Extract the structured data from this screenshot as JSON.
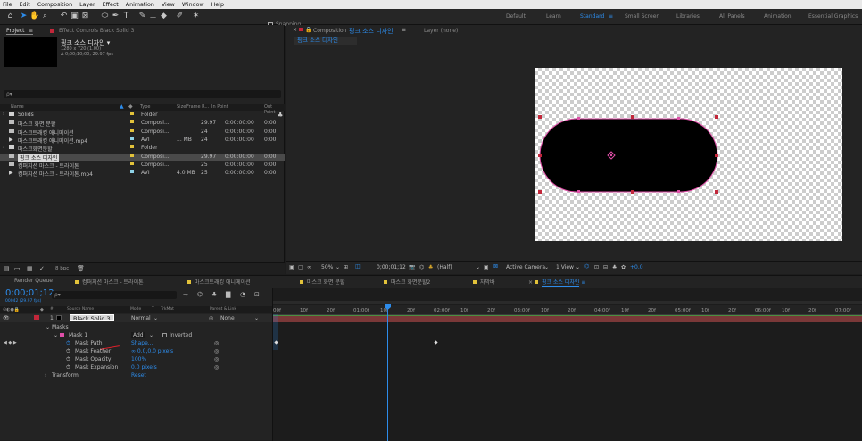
{
  "menu": [
    "File",
    "Edit",
    "Composition",
    "Layer",
    "Effect",
    "Animation",
    "View",
    "Window",
    "Help"
  ],
  "toolbar": {
    "snapping": "Snapping"
  },
  "workspaces": [
    "Default",
    "Learn",
    "Standard",
    "Small Screen",
    "Libraries",
    "All Panels",
    "Animation",
    "Essential Graphics"
  ],
  "project": {
    "tab": "Project",
    "tab_menu": "≡",
    "effect_controls": "Effect Controls Black Solid 3",
    "comp_name": "핑크 소스 디자인 ▾",
    "comp_res": "1280 x 720 (1.00)",
    "comp_dur": "Δ 0;00;10;00, 29.97 fps",
    "search_placeholder": "ρ▾",
    "columns": {
      "name": "Name",
      "type": "Type",
      "size": "Size",
      "frame_rate": "Frame R...",
      "in_point": "In Point",
      "out_point": "Out Point"
    },
    "items": [
      {
        "name": "Solids",
        "type": "Folder",
        "size": "",
        "fr": "",
        "in": "",
        "out": "",
        "color": "#e2c23a",
        "icon": "folder-icon"
      },
      {
        "name": "마스크 화면 분할",
        "type": "Composi...",
        "size": "",
        "fr": "29.97",
        "in": "0:00:00:00",
        "out": "0:00",
        "color": "#e2c23a",
        "icon": "composition-icon"
      },
      {
        "name": "마스크트래킹 애니메이션",
        "type": "Composi...",
        "size": "",
        "fr": "24",
        "in": "0:00:00:00",
        "out": "0:00",
        "color": "#e2c23a",
        "icon": "composition-icon"
      },
      {
        "name": "마스크트래킹 애니메이션.mp4",
        "type": "AVI",
        "size": "... MB",
        "fr": "24",
        "in": "0:00:00:00",
        "out": "0:00",
        "color": "#8fd3e8",
        "icon": "footage-icon"
      },
      {
        "name": "마스크화면분할",
        "type": "Folder",
        "size": "",
        "fr": "",
        "in": "",
        "out": "",
        "color": "#e2c23a",
        "icon": "folder-icon"
      },
      {
        "name": "핑크 소스 디자인",
        "type": "Composi...",
        "size": "",
        "fr": "29.97",
        "in": "0:00:00:00",
        "out": "0:00",
        "color": "#e2c23a",
        "icon": "composition-icon"
      },
      {
        "name": "컴퍼지션 마스크 - 트라이톤",
        "type": "Composi...",
        "size": "",
        "fr": "25",
        "in": "0:00:00:00",
        "out": "0:00",
        "color": "#e2c23a",
        "icon": "composition-icon"
      },
      {
        "name": "컴퍼지션 마스크 - 트라이톤.mp4",
        "type": "AVI",
        "size": "4.0 MB",
        "fr": "25",
        "in": "0:00:00:00",
        "out": "0:00",
        "color": "#8fd3e8",
        "icon": "footage-icon"
      }
    ],
    "bpc": "8 bpc"
  },
  "comp": {
    "tab_prefix": "Composition",
    "tab_name": "핑크 소스 디자인",
    "tab_menu": "≡",
    "layer_tab": "Layer (none)",
    "subtab": "핑크 소스 디자인",
    "zoom": "50%",
    "timecode": "0;00;01;12",
    "resolution": "(Half)",
    "camera": "Active Camera",
    "views": "1 View",
    "exposure": "+0.0"
  },
  "timeline": {
    "render_queue": "Render Queue",
    "tabs": [
      {
        "name": "컴퍼지션 마스크 - 트라이톤",
        "color": "#e2c23a"
      },
      {
        "name": "마스크트래킹 애니메이션",
        "color": "#e2c23a"
      },
      {
        "name": "마스크 화면 분할",
        "color": "#e2c23a"
      },
      {
        "name": "마스크 화면분할2",
        "color": "#e2c23a"
      },
      {
        "name": "자막바",
        "color": "#e2c23a"
      },
      {
        "name": "핑크 소스 디자인",
        "color": "#e2c23a"
      }
    ],
    "active_tab_menu": "≡",
    "timecode": "0;00;01;12",
    "fps_sub": "00042 (29.97 fps)",
    "search_placeholder": "ρ▾",
    "headers": {
      "hash": "#",
      "source": "Source Name",
      "mode": "Mode",
      "t": "T",
      "trkmat": "TrkMat",
      "parent": "Parent & Link"
    },
    "layer": {
      "num": "1",
      "name": "Black Solid 3",
      "mode": "Normal",
      "parent": "None"
    },
    "masks_label": "Masks",
    "mask1": "Mask 1",
    "mask_mode": "Add",
    "inverted": "Inverted",
    "props": [
      {
        "name": "Mask Path",
        "value": "Shape..."
      },
      {
        "name": "Mask Feather",
        "value": "∞ 0.0,0.0 pixels"
      },
      {
        "name": "Mask Opacity",
        "value": "100%"
      },
      {
        "name": "Mask Expansion",
        "value": "0.0 pixels"
      }
    ],
    "transform": "Transform",
    "reset": "Reset",
    "ruler": [
      "00f",
      "10f",
      "20f",
      "01:00f",
      "10f",
      "20f",
      "02:00f",
      "10f",
      "20f",
      "03:00f",
      "10f",
      "20f",
      "04:00f",
      "10f",
      "20f",
      "05:00f",
      "10f",
      "20f",
      "06:00f",
      "10f",
      "20f",
      "07:00f"
    ]
  },
  "colors": {
    "accent": "#2d8ceb",
    "label_red": "#c2273a",
    "mask_pink": "#e04fa8",
    "mask_path_line": "#8a4aa8",
    "layer_bar": "#8c3a3a"
  }
}
